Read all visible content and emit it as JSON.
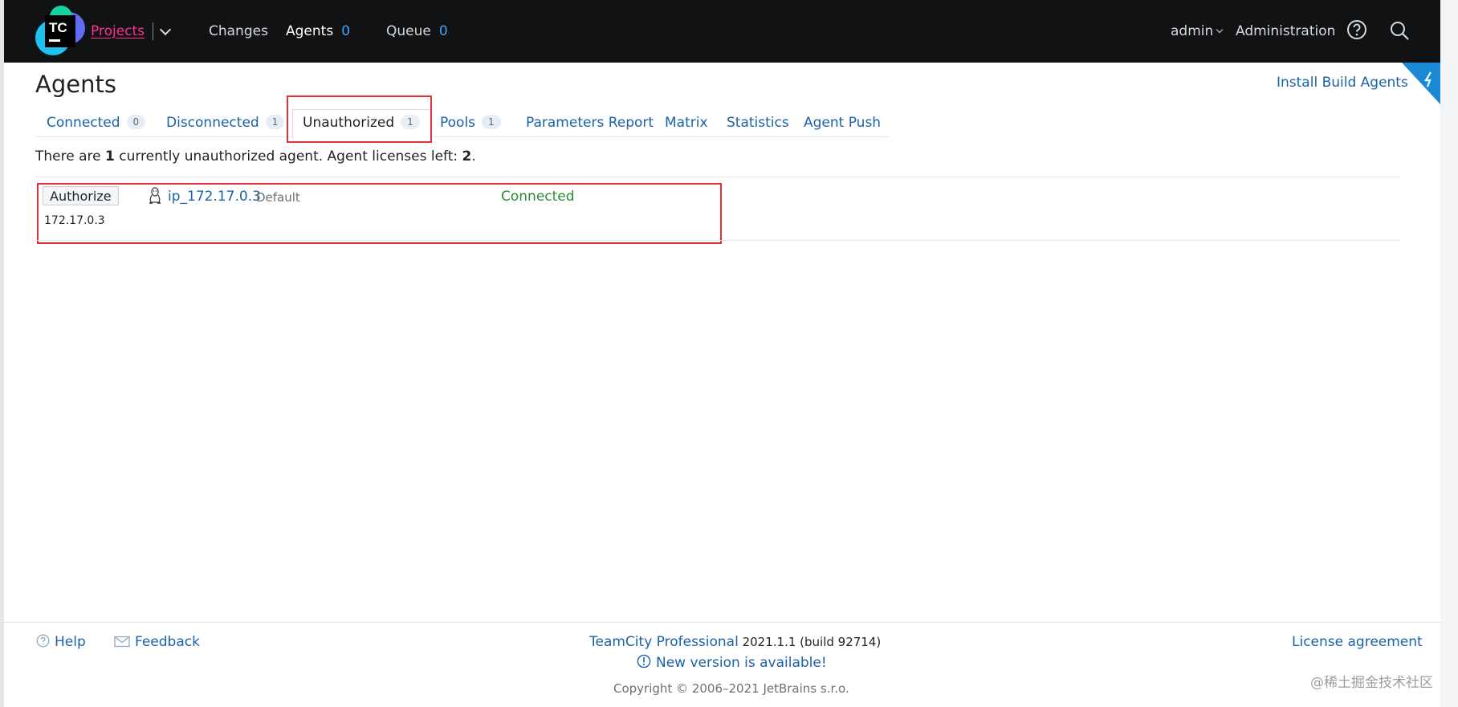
{
  "topbar": {
    "logo_text": "TC",
    "projects": "Projects",
    "changes": "Changes",
    "agents": "Agents",
    "agents_count": "0",
    "queue": "Queue",
    "queue_count": "0",
    "user": "admin",
    "administration": "Administration"
  },
  "page": {
    "title": "Agents",
    "install_link": "Install Build Agents"
  },
  "tabs": [
    {
      "label": "Connected",
      "count": "0"
    },
    {
      "label": "Disconnected",
      "count": "1"
    },
    {
      "label": "Unauthorized",
      "count": "1"
    },
    {
      "label": "Pools",
      "count": "1"
    },
    {
      "label": "Parameters Report"
    },
    {
      "label": "Matrix"
    },
    {
      "label": "Statistics"
    },
    {
      "label": "Agent Push"
    }
  ],
  "info": {
    "prefix": "There are ",
    "count": "1",
    "middle": " currently unauthorized agent. Agent licenses left: ",
    "licenses": "2",
    "suffix": "."
  },
  "agent": {
    "authorize_label": "Authorize",
    "os_icon": "linux-icon",
    "name": "ip_172.17.0.3",
    "pool": "Default",
    "status": "Connected",
    "ip": "172.17.0.3"
  },
  "footer": {
    "help": "Help",
    "feedback": "Feedback",
    "product": "TeamCity Professional",
    "version": " 2021.1.1 (build 92714)",
    "new_version": "New version is available!",
    "copyright": "Copyright © 2006–2021 JetBrains s.r.o.",
    "license": "License agreement",
    "watermark": "@稀土掘金技术社区"
  },
  "colors": {
    "topbar_bg": "#111213",
    "projects_accent": "#ff318c",
    "link": "#1b62a8",
    "status_connected": "#2f8a3a",
    "highlight_box": "#e03137"
  }
}
